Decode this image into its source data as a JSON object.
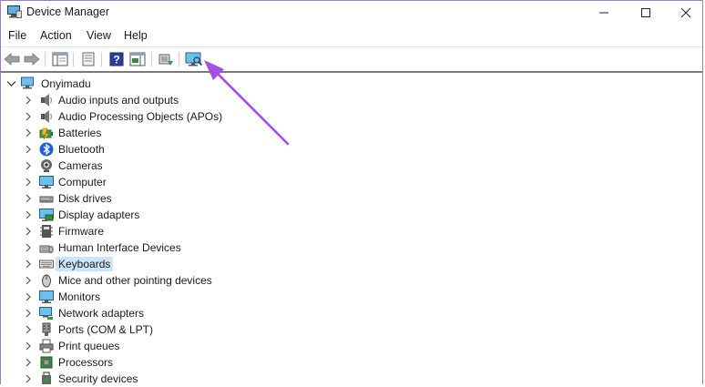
{
  "window": {
    "title": "Device Manager"
  },
  "menu": {
    "items": [
      "File",
      "Action",
      "View",
      "Help"
    ]
  },
  "toolbar": {
    "buttons": [
      "back-icon",
      "forward-icon",
      "show-hide-console-tree-icon",
      "properties-icon",
      "help-icon",
      "action-pane-icon",
      "update-driver-icon",
      "scan-hardware-icon"
    ]
  },
  "tree": {
    "root": "Onyimadu",
    "items": [
      {
        "label": "Audio inputs and outputs",
        "icon": "speaker-icon"
      },
      {
        "label": "Audio Processing Objects (APOs)",
        "icon": "speaker-icon"
      },
      {
        "label": "Batteries",
        "icon": "battery-icon"
      },
      {
        "label": "Bluetooth",
        "icon": "bluetooth-icon"
      },
      {
        "label": "Cameras",
        "icon": "camera-icon"
      },
      {
        "label": "Computer",
        "icon": "monitor-icon"
      },
      {
        "label": "Disk drives",
        "icon": "disk-drive-icon"
      },
      {
        "label": "Display adapters",
        "icon": "display-adapter-icon"
      },
      {
        "label": "Firmware",
        "icon": "firmware-icon"
      },
      {
        "label": "Human Interface Devices",
        "icon": "hid-icon"
      },
      {
        "label": "Keyboards",
        "icon": "keyboard-icon",
        "selected": true
      },
      {
        "label": "Mice and other pointing devices",
        "icon": "mouse-icon"
      },
      {
        "label": "Monitors",
        "icon": "monitor-icon"
      },
      {
        "label": "Network adapters",
        "icon": "network-adapter-icon"
      },
      {
        "label": "Ports (COM & LPT)",
        "icon": "port-icon"
      },
      {
        "label": "Print queues",
        "icon": "printer-icon"
      },
      {
        "label": "Processors",
        "icon": "processor-icon"
      },
      {
        "label": "Security devices",
        "icon": "security-device-icon"
      }
    ]
  },
  "colors": {
    "accent_arrow": "#a64ee6",
    "selection": "#cce4f7",
    "window_border": "#9b7fb8"
  }
}
